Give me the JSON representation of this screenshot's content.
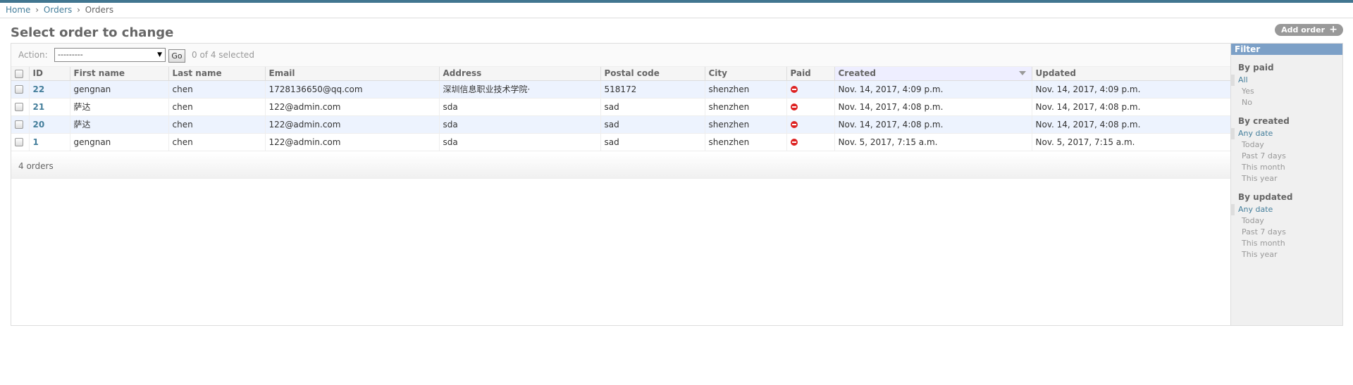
{
  "breadcrumbs": {
    "home": "Home",
    "app": "Orders",
    "model": "Orders",
    "sep": "›"
  },
  "title": "Select order to change",
  "add_button": {
    "label": "Add order",
    "icon": "plus-icon"
  },
  "actions": {
    "label": "Action:",
    "selected": "---------",
    "go": "Go",
    "count": "0 of 4 selected"
  },
  "columns": [
    "ID",
    "First name",
    "Last name",
    "Email",
    "Address",
    "Postal code",
    "City",
    "Paid",
    "Created",
    "Updated"
  ],
  "rows": [
    {
      "id": "22",
      "first_name": "gengnan",
      "last_name": "chen",
      "email": "1728136650@qq.com",
      "address": "深圳信息职业技术学院·",
      "postal_code": "518172",
      "city": "shenzhen",
      "paid": "no-icon",
      "created": "Nov. 14, 2017, 4:09 p.m.",
      "updated": "Nov. 14, 2017, 4:09 p.m."
    },
    {
      "id": "21",
      "first_name": "萨达",
      "last_name": "chen",
      "email": "122@admin.com",
      "address": "sda",
      "postal_code": "sad",
      "city": "shenzhen",
      "paid": "no-icon",
      "created": "Nov. 14, 2017, 4:08 p.m.",
      "updated": "Nov. 14, 2017, 4:08 p.m."
    },
    {
      "id": "20",
      "first_name": "萨达",
      "last_name": "chen",
      "email": "122@admin.com",
      "address": "sda",
      "postal_code": "sad",
      "city": "shenzhen",
      "paid": "no-icon",
      "created": "Nov. 14, 2017, 4:08 p.m.",
      "updated": "Nov. 14, 2017, 4:08 p.m."
    },
    {
      "id": "1",
      "first_name": "gengnan",
      "last_name": "chen",
      "email": "122@admin.com",
      "address": "sda",
      "postal_code": "sad",
      "city": "shenzhen",
      "paid": "no-icon",
      "created": "Nov. 5, 2017, 7:15 a.m.",
      "updated": "Nov. 5, 2017, 7:15 a.m."
    }
  ],
  "paginator": "4 orders",
  "filter": {
    "title": "Filter",
    "groups": [
      {
        "title": "By paid",
        "options": [
          "All",
          "Yes",
          "No"
        ],
        "selected": "All"
      },
      {
        "title": "By created",
        "options": [
          "Any date",
          "Today",
          "Past 7 days",
          "This month",
          "This year"
        ],
        "selected": "Any date"
      },
      {
        "title": "By updated",
        "options": [
          "Any date",
          "Today",
          "Past 7 days",
          "This month",
          "This year"
        ],
        "selected": "Any date"
      }
    ]
  },
  "colors": {
    "header_bar": "#417690",
    "link": "#447e9b",
    "filter_header": "#7ca0c7",
    "row_alt": "#edf3fe",
    "no_icon": "#dd2222"
  }
}
